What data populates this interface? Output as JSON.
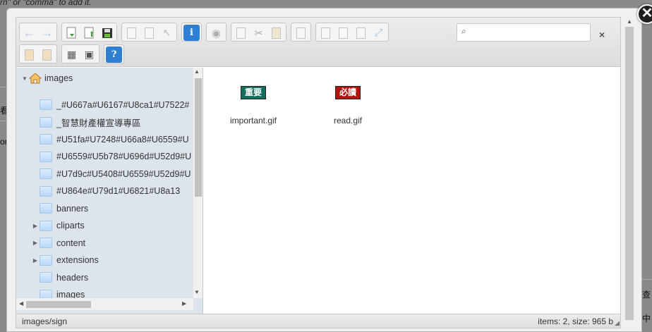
{
  "background": {
    "top_hint": "rn\" or \"comma\" to add it.",
    "left_edge_chars": [
      "看",
      "or"
    ],
    "right_edge_chars": [
      "查",
      "中"
    ]
  },
  "dialog": {
    "close_symbol": "✕"
  },
  "toolbar": {
    "search_placeholder": "",
    "clear_symbol": "×",
    "info_symbol": "i",
    "help_symbol": "?"
  },
  "tree": {
    "root": "images",
    "items": [
      {
        "label": "_#U667a#U6167#U8ca1#U7522#",
        "expandable": false
      },
      {
        "label": "_智慧財產權宣導專區",
        "expandable": false
      },
      {
        "label": "#U51fa#U7248#U66a8#U6559#U",
        "expandable": false
      },
      {
        "label": "#U6559#U5b78#U696d#U52d9#U",
        "expandable": false
      },
      {
        "label": "#U7d9c#U5408#U6559#U52d9#U",
        "expandable": false
      },
      {
        "label": "#U864e#U79d1#U6821#U8a13",
        "expandable": false
      },
      {
        "label": "banners",
        "expandable": false
      },
      {
        "label": "cliparts",
        "expandable": true
      },
      {
        "label": "content",
        "expandable": true
      },
      {
        "label": "extensions",
        "expandable": true
      },
      {
        "label": "headers",
        "expandable": false
      },
      {
        "label": "images",
        "expandable": false
      }
    ]
  },
  "files": [
    {
      "name": "important.gif",
      "thumb_text": "重要",
      "thumb_color": "#146e5e"
    },
    {
      "name": "read.gif",
      "thumb_text": "必讀",
      "thumb_color": "#b3140f"
    }
  ],
  "statusbar": {
    "path": "images/sign",
    "info": "items: 2, size: 965 b"
  }
}
